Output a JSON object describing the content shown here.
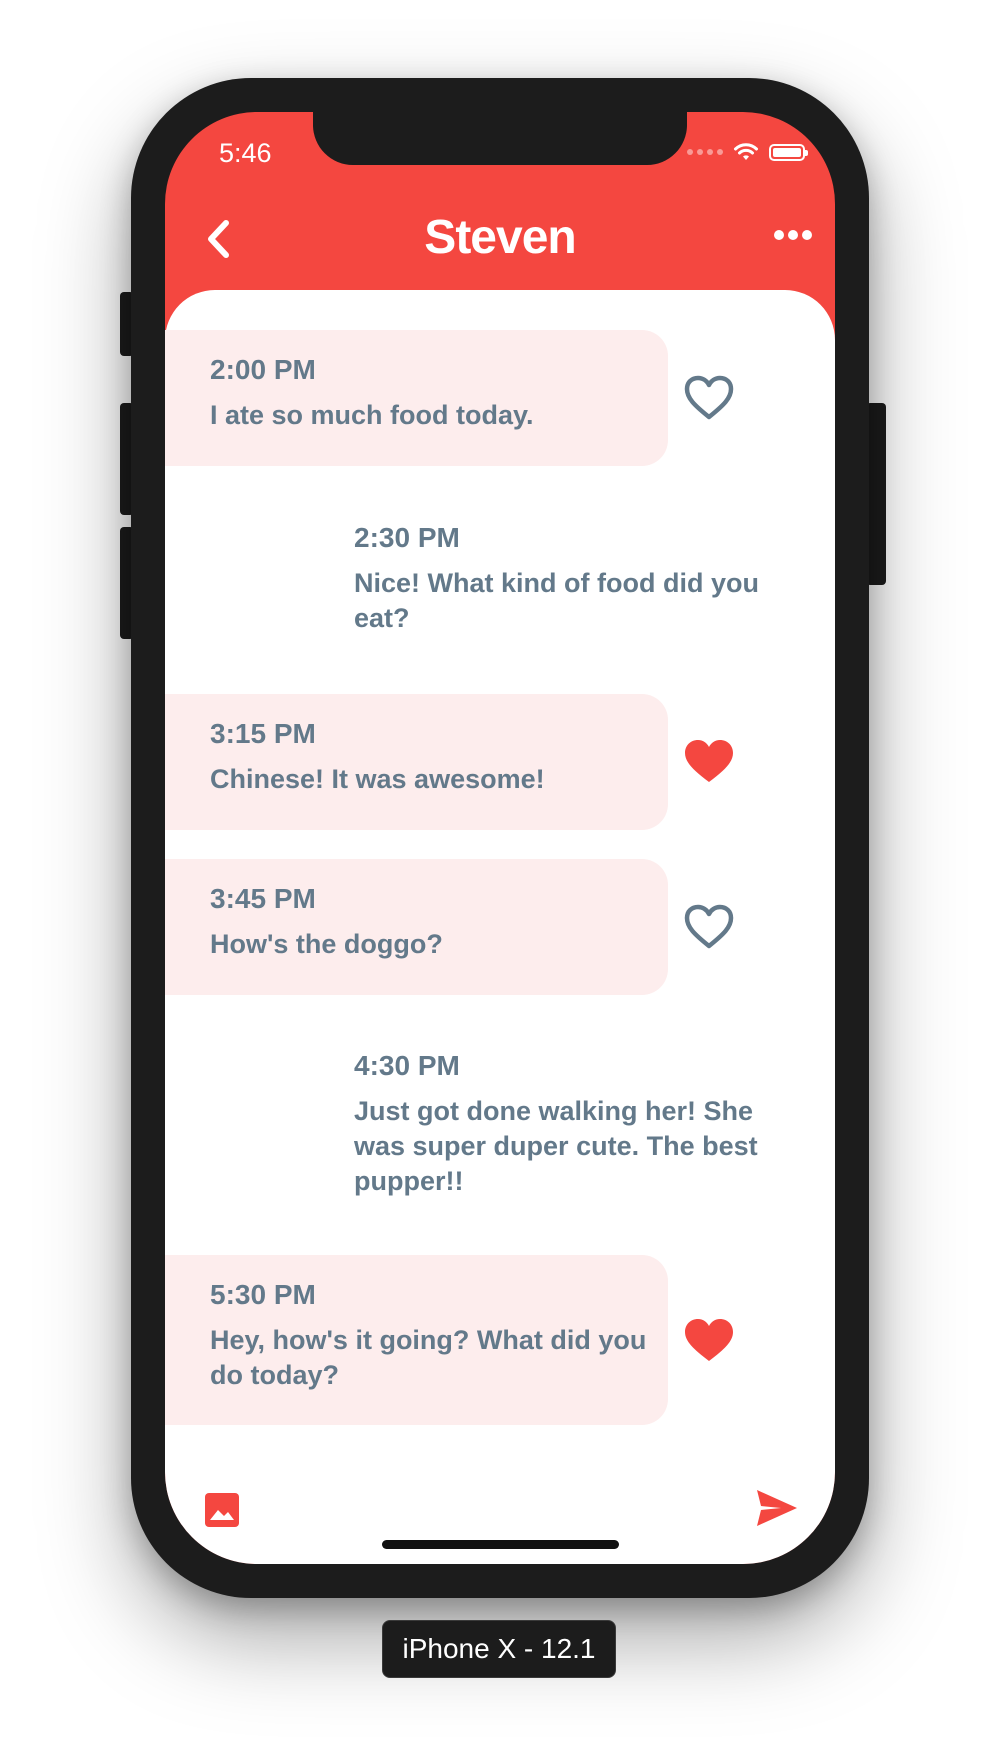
{
  "status_bar": {
    "time": "5:46"
  },
  "header": {
    "title": "Steven",
    "back_icon": "chevron-left-icon",
    "more_icon": "more-horizontal-icon"
  },
  "messages": [
    {
      "direction": "incoming",
      "time": "2:00 PM",
      "text": "I ate so much food today.",
      "liked": false
    },
    {
      "direction": "outgoing",
      "time": "2:30 PM",
      "text": "Nice! What kind of food did you eat?"
    },
    {
      "direction": "incoming",
      "time": "3:15 PM",
      "text": "Chinese! It was awesome!",
      "liked": true
    },
    {
      "direction": "incoming",
      "time": "3:45 PM",
      "text": "How's the doggo?",
      "liked": false
    },
    {
      "direction": "outgoing",
      "time": "4:30 PM",
      "text": "Just got done walking her! She was super duper cute. The best pupper!!"
    },
    {
      "direction": "incoming",
      "time": "5:30 PM",
      "text": "Hey, how's it going? What did you do today?",
      "liked": true
    }
  ],
  "composer": {
    "image_icon": "image-icon",
    "send_icon": "send-icon"
  },
  "device_label": "iPhone X - 12.1",
  "colors": {
    "accent": "#f44740",
    "bubble": "#fdeded",
    "text": "#63798a",
    "heart_outline": "#63798a"
  }
}
